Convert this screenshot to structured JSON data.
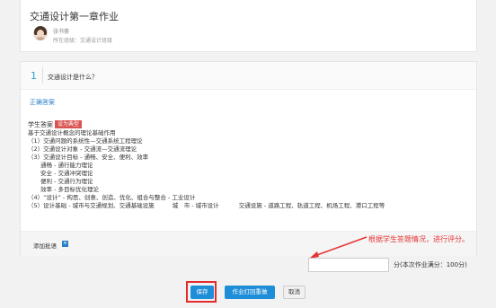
{
  "homework": {
    "title": "交通设计第一章作业",
    "teacher_name": "张书豪",
    "class_line": "所在班级：交通设计班级"
  },
  "question": {
    "number": "1",
    "text": "交通设计是什么？",
    "correct_answer_link": "正确答案"
  },
  "answer": {
    "label": "学生答案",
    "typical_badge": "设为典型",
    "lines": [
      "基于交通设计概念的理论基础作用",
      "（1）交通问题的系统性—交通系统工程理论",
      "（2）交通设计对象 - 交通流—交通流理论",
      "（3）交通设计目标 - 通畅、安全、便利、效率",
      "通畅 - 通行能力理论",
      "安全 - 交通冲突理论",
      "便利 - 交通行为理论",
      "效率 - 多目标优化理论",
      "（4）“设计” - 构思、创意、创造、优化、组合与整合 - 工业设计",
      "（5）设计基础 - 城市与交通规划、交通基础设施",
      "城　市 - 城市设计",
      "交通设施 - 道路工程、轨道工程、机场工程、港口工程等"
    ]
  },
  "comment": {
    "add_label": "添加批语",
    "toggle_glyph": "≡"
  },
  "annotation": {
    "hint": "根据学生答题情况，进行评分。"
  },
  "score": {
    "value": "",
    "suffix": "分(本次作业满分：100分)"
  },
  "buttons": {
    "save": "保存",
    "print_back": "作业打回重做",
    "cancel": "取消"
  },
  "colors": {
    "accent": "#1f8ed8",
    "badge": "#d9534f",
    "annotation_red": "#e53333",
    "link": "#2a7fc9"
  }
}
